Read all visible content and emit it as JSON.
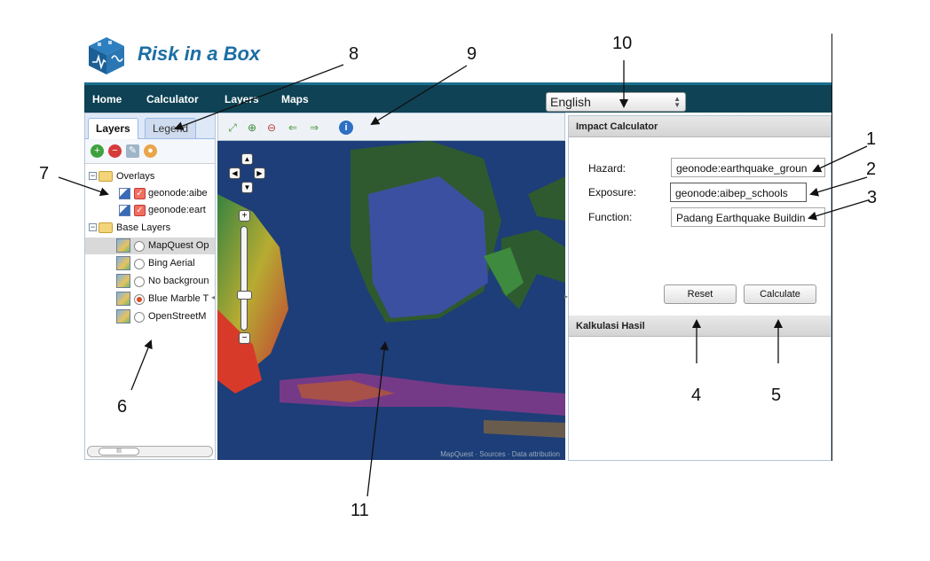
{
  "app": {
    "title": "Risk in a Box"
  },
  "nav": {
    "items": [
      "Home",
      "Calculator",
      "Layers",
      "Maps"
    ],
    "language": "English"
  },
  "left_panel": {
    "tabs": [
      "Layers",
      "Legend"
    ],
    "tools": [
      "add-icon",
      "remove-icon",
      "wrench-icon",
      "palette-icon"
    ],
    "groups": [
      {
        "label": "Overlays",
        "items": [
          "geonode:aibe",
          "geonode:eart"
        ]
      },
      {
        "label": "Base Layers",
        "items": [
          "MapQuest Op",
          "Bing Aerial",
          "No backgroun",
          "Blue Marble T",
          "OpenStreetM"
        ],
        "selected": "Blue Marble T"
      }
    ],
    "scroll_thumb": "III"
  },
  "map": {
    "toolbar": [
      "zoom-extent-icon",
      "zoom-in-icon",
      "zoom-out-icon",
      "back-icon",
      "forward-icon",
      "info-icon"
    ],
    "attribution": "MapQuest · Sources · Data attribution"
  },
  "impact_calculator": {
    "title": "Impact Calculator",
    "hazard_label": "Hazard:",
    "hazard_value": "geonode:earthquake_groun",
    "exposure_label": "Exposure:",
    "exposure_value": "geonode:aibep_schools",
    "function_label": "Function:",
    "function_value": "Padang Earthquake Buildin",
    "reset_label": "Reset",
    "calculate_label": "Calculate"
  },
  "result": {
    "title": "Kalkulasi Hasil"
  },
  "callouts": [
    "1",
    "2",
    "3",
    "4",
    "5",
    "6",
    "7",
    "8",
    "9",
    "10",
    "11"
  ],
  "colors": {
    "navbar": "#0e4254",
    "brand": "#1c6ea4",
    "ocean": "#1d3e78"
  }
}
